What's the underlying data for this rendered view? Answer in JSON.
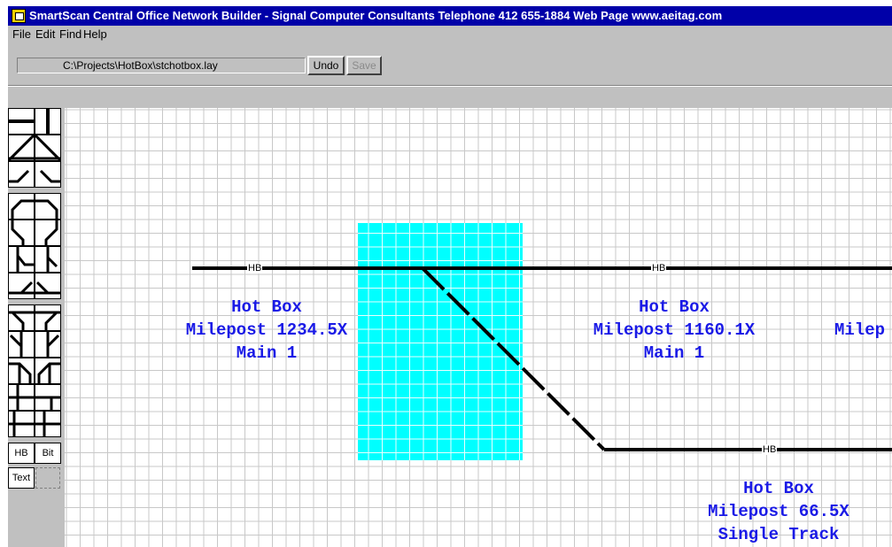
{
  "window": {
    "title": "SmartScan Central Office Network Builder - Signal Computer Consultants  Telephone 412 655-1884  Web Page www.aeitag.com"
  },
  "menu": {
    "items": [
      "File",
      "Edit",
      "Find",
      "Help"
    ]
  },
  "toolbar": {
    "file_path": "C:\\Projects\\HotBox\\stchotbox.lay",
    "undo_label": "Undo",
    "save_label": "Save",
    "save_enabled": false
  },
  "palette": {
    "track_tools": [
      "straight-horizontal",
      "straight-vertical",
      "diagonal-up",
      "diagonal-down",
      "curve-left",
      "curve-right",
      "curve-top-left",
      "curve-top-right",
      "switch-left-down",
      "switch-right-down",
      "switch-up-left",
      "switch-up-right",
      "crossover-left",
      "crossover-right",
      "turnout-a",
      "turnout-b",
      "turnout-c",
      "turnout-d",
      "tee-left",
      "tee-right",
      "tee-up",
      "tee-down"
    ],
    "hb_label": "HB",
    "bit_label": "Bit",
    "text_label": "Text"
  },
  "canvas": {
    "highlight_color": "#00ffff",
    "grid_color": "#c8c8c8",
    "label_color": "#1a1ae6",
    "detectors": [
      {
        "tag": "HB",
        "lines": [
          "Hot Box",
          "Milepost 1234.5X",
          "Main 1"
        ]
      },
      {
        "tag": "HB",
        "lines": [
          "Hot Box",
          "Milepost 1160.1X",
          "Main 1"
        ]
      },
      {
        "tag": "HB",
        "lines": [
          "Hot Box",
          "Milepost 66.5X",
          "Single Track"
        ]
      }
    ],
    "partial_label": "Milep"
  }
}
